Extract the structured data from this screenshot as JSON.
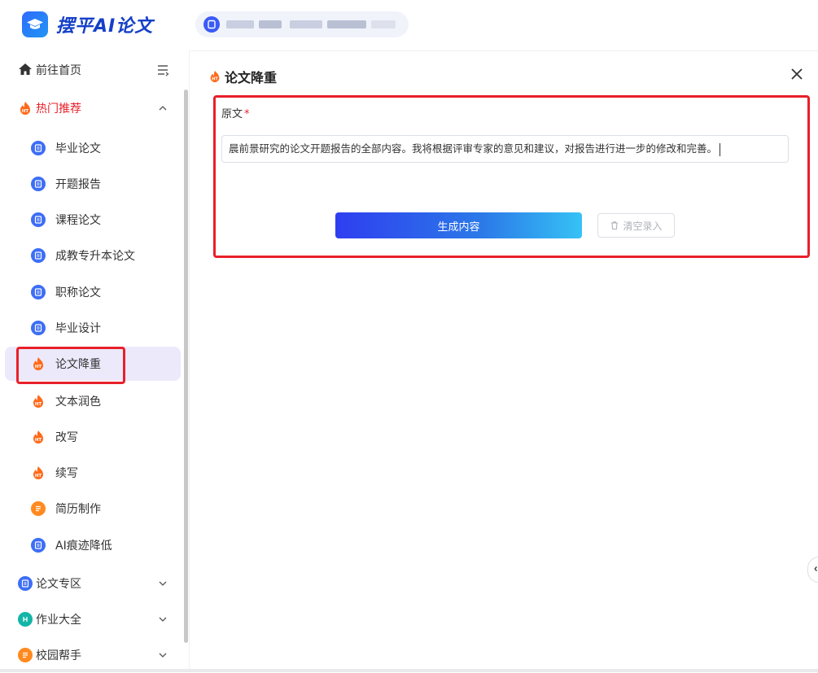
{
  "header": {
    "logo_text": "摆平AI论文"
  },
  "sidebar": {
    "home": "前往首页",
    "hot_group": "热门推荐",
    "hot_items": [
      {
        "label": "毕业论文",
        "icon": "doc-icon"
      },
      {
        "label": "开题报告",
        "icon": "doc-icon"
      },
      {
        "label": "课程论文",
        "icon": "doc-icon"
      },
      {
        "label": "成教专升本论文",
        "icon": "doc-icon"
      },
      {
        "label": "职称论文",
        "icon": "doc-icon"
      },
      {
        "label": "毕业设计",
        "icon": "doc-icon"
      },
      {
        "label": "论文降重",
        "icon": "fire-hot-icon"
      },
      {
        "label": "文本润色",
        "icon": "fire-hot-icon"
      },
      {
        "label": "改写",
        "icon": "fire-hot-icon"
      },
      {
        "label": "续写",
        "icon": "fire-hot-icon"
      },
      {
        "label": "简历制作",
        "icon": "resume-icon"
      },
      {
        "label": "AI痕迹降低",
        "icon": "doc-icon"
      }
    ],
    "groups": [
      {
        "label": "论文专区"
      },
      {
        "label": "作业大全"
      },
      {
        "label": "校园帮手"
      }
    ]
  },
  "main": {
    "title": "论文降重",
    "field_label": "原文",
    "required_mark": "*",
    "input_value": "晨前景研究的论文开题报告的全部内容。我将根据评审专家的意见和建议，对报告进行进一步的修改和完善。",
    "generate_button": "生成内容",
    "clear_button": "清空录入"
  },
  "colors": {
    "accent": "#2f3ef0",
    "highlight_red": "#e8202a",
    "active_bg": "#ece9fb",
    "hot_orange": "#ff8a1f",
    "doc_blue": "#3d6ef5"
  }
}
